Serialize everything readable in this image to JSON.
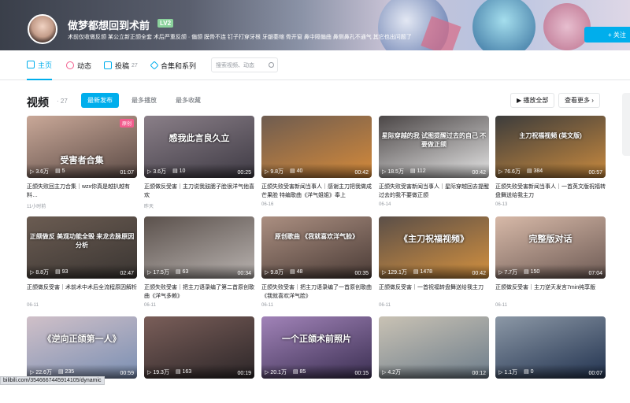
{
  "header": {
    "username": "做梦都想回到术前",
    "level": "LV2",
    "signature": "术前仅收做反颌 某公立新正颌全套 术后严重反颌 · 偏颌 膜骨不连 钉子打穿牙根 牙龈萎缩 骨开窗 鼻中隔偏曲 鼻侧鼻孔不通气 其它也出问题了",
    "follow_label": "+ 关注"
  },
  "nav": {
    "tabs": [
      {
        "label": "主页",
        "count": ""
      },
      {
        "label": "动态",
        "count": ""
      },
      {
        "label": "投稿",
        "count": "27"
      },
      {
        "label": "合集和系列",
        "count": ""
      }
    ],
    "search_placeholder": "搜索视频、动态"
  },
  "videos": {
    "title": "视频",
    "count": "· 27",
    "sort": [
      "最新发布",
      "最多播放",
      "最多收藏"
    ],
    "play_all": "▶ 播放全部",
    "more": "查看更多 ›"
  },
  "cards": [
    {
      "overlay": "受害者合集",
      "badge": "原创",
      "views": "3.6万",
      "comments": "5",
      "duration": "01:07",
      "title": "正颌失败回主刀合集｜wzx你真是越扒越有料…",
      "date": "11小时前",
      "color1": "#5b4a45",
      "color2": "#c9a898"
    },
    {
      "overlay": "感我此言良久立",
      "badge": "",
      "views": "3.6万",
      "comments": "10",
      "duration": "00:25",
      "title": "正颌做反受害｜主刀说我鼓腮子脸很洋气他喜欢",
      "date": "昨天",
      "color1": "#3e3a44",
      "color2": "#8a7f88"
    },
    {
      "overlay": "",
      "badge": "",
      "views": "9.8万",
      "comments": "40",
      "duration": "00:42",
      "title": "正颌失败受害新闻当事人｜感谢主刀把我做成芒果脸 特编歌曲《洋气姐姐》奉上",
      "date": "06-16",
      "color1": "#d58a3a",
      "color2": "#6e5c50"
    },
    {
      "overlay": "星际穿越的我 试图提醒过去的自己 不要做正颌",
      "badge": "",
      "views": "18.5万",
      "comments": "112",
      "duration": "00:42",
      "title": "正颌失败受害新闻当事人｜星际穿越回去提醒过去的我不要做正颌",
      "date": "06-14",
      "color1": "#e6e6e6",
      "color2": "#4b4646"
    },
    {
      "overlay": "主刀祝福视频 (英文版)",
      "badge": "",
      "views": "76.6万",
      "comments": "384",
      "duration": "00:57",
      "title": "正颌失败受害新闻当事人｜一首英文版祝福转盘舞送给我主刀",
      "date": "06-13",
      "color1": "#c98a3e",
      "color2": "#3c3c3c"
    },
    {
      "overlay": "正颌做反 美观功能全毁 来龙去脉原因分析",
      "badge": "",
      "views": "8.8万",
      "comments": "93",
      "duration": "02:47",
      "title": "正颌做反受害｜术前术中术后全流程原因解析",
      "date": "06-11",
      "color1": "#3a3532",
      "color2": "#6b5c52"
    },
    {
      "overlay": "",
      "badge": "",
      "views": "17.5万",
      "comments": "63",
      "duration": "00:34",
      "title": "正颌失败受害｜把主刀语录编了第二首原创歌曲《洋气多赖》",
      "date": "06-11",
      "color1": "#b9b3b0",
      "color2": "#5b514c"
    },
    {
      "overlay": "原创歌曲 《我就喜欢洋气脸》",
      "badge": "",
      "views": "9.8万",
      "comments": "48",
      "duration": "00:35",
      "title": "正颌失败受害｜把主刀语录编了一首原创歌曲《我就喜欢洋气脸》",
      "date": "06-11",
      "color1": "#4a3b36",
      "color2": "#ab8f81"
    },
    {
      "overlay": "《主刀祝福视频》",
      "badge": "",
      "views": "129.1万",
      "comments": "1478",
      "duration": "00:42",
      "title": "正颌做反受害｜一首祝福转盘舞送给我主刀",
      "date": "06-11",
      "color1": "#d4913f",
      "color2": "#5b4f48"
    },
    {
      "overlay": "完整版对话",
      "badge": "",
      "views": "7.7万",
      "comments": "150",
      "duration": "07:04",
      "title": "正颌做反受害｜主刀逆天发言7min纯享版",
      "date": "06-11",
      "color1": "#6d5a54",
      "color2": "#d7b9a8"
    },
    {
      "overlay": "《逆向正颌第一人》",
      "badge": "",
      "views": "22.6万",
      "comments": "235",
      "duration": "00:59",
      "title": "",
      "date": "",
      "color1": "#7a8fb3",
      "color2": "#d0c0c8"
    },
    {
      "overlay": "",
      "badge": "",
      "views": "19.3万",
      "comments": "163",
      "duration": "00:19",
      "title": "",
      "date": "",
      "color1": "#2c2628",
      "color2": "#7a5e59"
    },
    {
      "overlay": "一个正颌术前照片",
      "badge": "",
      "views": "20.1万",
      "comments": "85",
      "duration": "00:15",
      "title": "",
      "date": "",
      "color1": "#3b2f52",
      "color2": "#a183b8"
    },
    {
      "overlay": "",
      "badge": "",
      "views": "4.2万",
      "comments": "",
      "duration": "00:12",
      "title": "",
      "date": "",
      "color1": "#6d7d8b",
      "color2": "#c9c2b4"
    },
    {
      "overlay": "",
      "badge": "",
      "views": "1.1万",
      "comments": "0",
      "duration": "00:07",
      "title": "",
      "date": "",
      "color1": "#21324f",
      "color2": "#8c98a6"
    }
  ],
  "status_url": "bilibili.com/3546667445914105/dynamic"
}
